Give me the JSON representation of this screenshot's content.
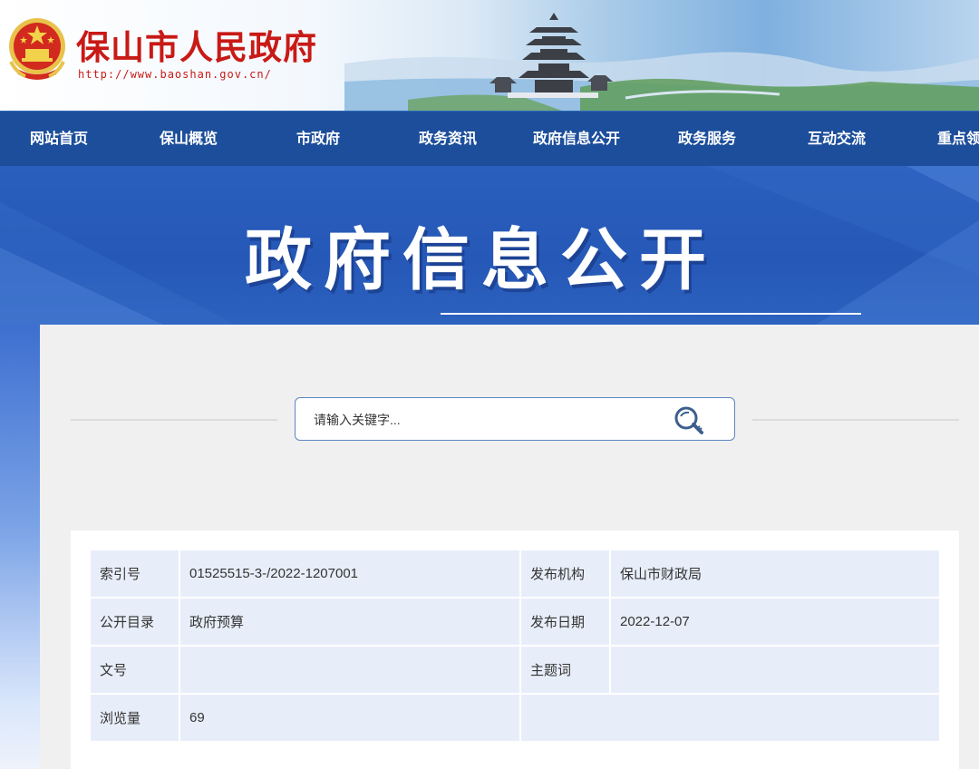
{
  "header": {
    "title": "保山市人民政府",
    "url": "http://www.baoshan.gov.cn/"
  },
  "nav": {
    "items": [
      {
        "label": "网站首页"
      },
      {
        "label": "保山概览"
      },
      {
        "label": "市政府"
      },
      {
        "label": "政务资讯"
      },
      {
        "label": "政府信息公开"
      },
      {
        "label": "政务服务"
      },
      {
        "label": "互动交流"
      },
      {
        "label": "重点领"
      }
    ]
  },
  "banner": {
    "title": "政府信息公开"
  },
  "search": {
    "placeholder": "请输入关键字..."
  },
  "meta_table": {
    "rows": [
      {
        "label": "索引号",
        "value": "01525515-3-/2022-1207001",
        "label2": "发布机构",
        "value2": "保山市财政局"
      },
      {
        "label": "公开目录",
        "value": "政府预算",
        "label2": "发布日期",
        "value2": "2022-12-07"
      },
      {
        "label": "文号",
        "value": "",
        "label2": "主题词",
        "value2": ""
      },
      {
        "label": "浏览量",
        "value": "69",
        "label2": "",
        "value2": ""
      }
    ]
  },
  "colors": {
    "brand_red": "#c81a16",
    "nav_blue": "#1c4e9b",
    "banner_blue": "#2658b7",
    "table_cell": "#e8eef9"
  },
  "icons": {
    "emblem": "national-emblem-icon",
    "search": "magnifier-key-icon"
  }
}
